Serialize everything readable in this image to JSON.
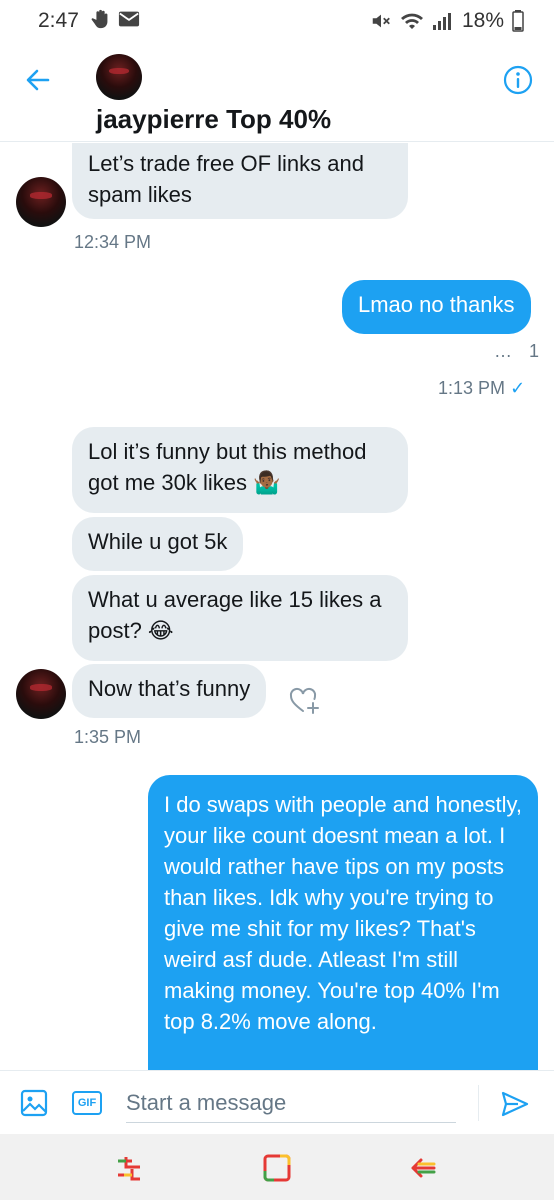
{
  "status_bar": {
    "time": "2:47",
    "battery": "18%"
  },
  "header": {
    "name": "jaaypierre Top 40%"
  },
  "messages": [
    {
      "text": "Let’s trade free OF links and spam likes"
    },
    {
      "timestamp": "12:34 PM"
    },
    {
      "text": "Lmao no thanks"
    },
    {
      "reaction_dots": "…",
      "reaction_count": "1"
    },
    {
      "timestamp": "1:13 PM",
      "check": "✓"
    },
    {
      "text": "Lol it’s funny but this method got me 30k likes 🤷🏾‍♂️"
    },
    {
      "text": "While u got 5k"
    },
    {
      "text": "What u average like 15 likes a post? 😂"
    },
    {
      "text": "Now that’s funny"
    },
    {
      "timestamp": "1:35 PM"
    },
    {
      "text": "I do swaps with people and honestly, your like count doesnt mean a lot. I would rather have tips on my posts than likes. Idk why you're trying to give me shit for my likes? That's weird asf dude. Atleast I'm still making money. You're top 40%  I'm top 8.2%  move along."
    }
  ],
  "composer": {
    "gif_label": "GIF",
    "placeholder": "Start a message"
  },
  "colors": {
    "accent": "#1da1f2",
    "incoming_bubble": "#e6ecf0",
    "timestamp": "#657786"
  }
}
